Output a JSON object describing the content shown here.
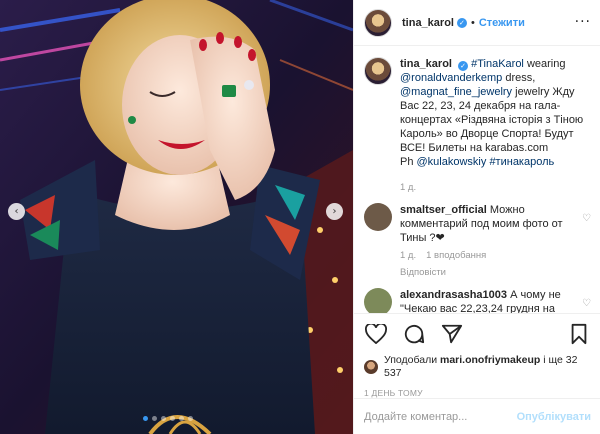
{
  "header": {
    "username": "tina_karol",
    "separator": "•",
    "follow_label": "Стежити",
    "more_label": "···"
  },
  "caption": {
    "username": "tina_karol",
    "hashtag_tina": "#TinaKarol",
    "text_wearing": " wearing ",
    "mention_dress": "@ronaldvanderkemp",
    "text_dress": " dress,",
    "mention_jewelry": "@magnat_fine_jewelry",
    "text_jewelry": " jewelry",
    "text_body": "Жду Вас 22, 23, 24 декабря на гала-концертах «Різдвяна історія з Тіною Кароль» во Дворце Спорта! Будут ВСЕ! Билеты на karabas.com",
    "text_ph": "Ph ",
    "mention_ph": "@kulakowskiy",
    "hashtag_ru": "#тинакароль",
    "time": "1 д."
  },
  "comments": [
    {
      "username": "smaltser_official",
      "text": "Можно комментарий под моим фото от Тины ?❤",
      "time": "1 д.",
      "likes": "1 вподобання",
      "reply": "Відповісти",
      "avatar_color": "#6d5a48"
    },
    {
      "username": "alexandrasasha1003",
      "text": "А чому не \"Чекаю вас 22,23,24 грудня на",
      "avatar_color": "#7d8a5a"
    }
  ],
  "likes": {
    "prefix": "Уподобали ",
    "user": "mari.onofriymakeup",
    "suffix": " і ще 32 537"
  },
  "timestamp": "1 ДЕНЬ ТОМУ",
  "add_comment": {
    "placeholder": "Додайте коментар...",
    "publish_label": "Опублікувати"
  },
  "icons": {
    "prev": "chevron-left-icon",
    "next": "chevron-right-icon",
    "like": "heart-icon",
    "comment": "comment-icon",
    "share": "share-icon",
    "save": "bookmark-icon",
    "verified": "verified-badge-icon"
  },
  "colors": {
    "accent": "#3897f0",
    "publish_disabled": "#b2dffc",
    "muted": "#999999"
  },
  "carousel": {
    "slides": 6,
    "active_index": 0
  }
}
